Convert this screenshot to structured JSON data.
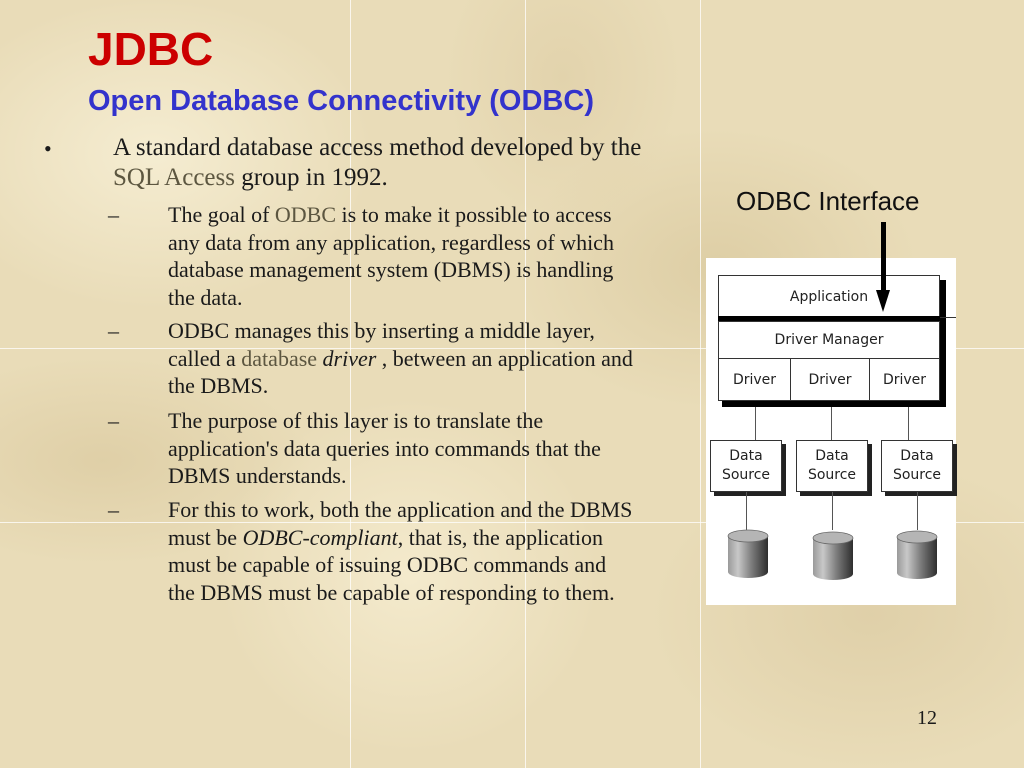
{
  "slide": {
    "title": "JDBC",
    "subtitle": "Open Database Connectivity (ODBC)",
    "page_number": "12",
    "colors": {
      "title": "#cc0000",
      "subtitle": "#3333cc",
      "text": "#1a1a1a",
      "muted_text": "#5c5640"
    }
  },
  "bullet": {
    "marker": "•",
    "text_part1": "A standard database access method developed by the ",
    "text_highlight": "SQL Access",
    "text_part2": " group in 1992."
  },
  "sub_bullets": [
    {
      "marker": "–",
      "part1": "The goal of ",
      "highlight": "ODBC",
      "part2": " is to make it possible to access any data from any application, regardless of which database management system (DBMS) is handling the data."
    },
    {
      "marker": "–",
      "part1": "ODBC manages this by inserting a middle layer, called a ",
      "highlight": "database",
      "italic": "driver",
      "part2": " , between an application and the DBMS."
    },
    {
      "marker": "–",
      "part1": "The purpose of this layer is to translate the application's data queries into commands that the DBMS understands."
    },
    {
      "marker": "–",
      "part1": "For this to work, both the application and the DBMS must be ",
      "italic": "ODBC-compliant",
      "part2": ", that is, the application must be capable of issuing ODBC commands and the DBMS must be capable of responding to them."
    }
  ],
  "diagram": {
    "interface_label": "ODBC Interface",
    "application_label": "Application",
    "driver_manager_label": "Driver Manager",
    "drivers": [
      "Driver",
      "Driver",
      "Driver"
    ],
    "data_sources": [
      {
        "line1": "Data",
        "line2": "Source"
      },
      {
        "line1": "Data",
        "line2": "Source"
      },
      {
        "line1": "Data",
        "line2": "Source"
      }
    ],
    "databases": [
      "database",
      "database",
      "database"
    ]
  }
}
